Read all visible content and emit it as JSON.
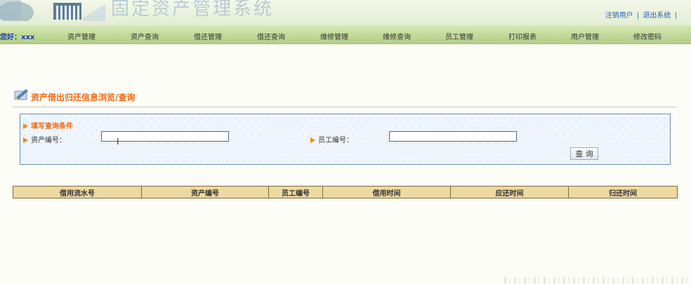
{
  "banner": {
    "system_title": "固定资产管理系统",
    "links": {
      "logout_user": "注销用户",
      "exit_system": "退出系统",
      "separator": "|"
    }
  },
  "nav": {
    "greeting": "您好：xxx",
    "items": [
      {
        "label": "资产管理"
      },
      {
        "label": "资产查询"
      },
      {
        "label": "借还管理"
      },
      {
        "label": "借还查询"
      },
      {
        "label": "维修管理"
      },
      {
        "label": "维修查询"
      },
      {
        "label": "员工管理"
      },
      {
        "label": "打印报表"
      },
      {
        "label": "用户管理"
      },
      {
        "label": "修改密码"
      }
    ]
  },
  "page": {
    "title": "资产借出归还信息浏览/查询"
  },
  "search": {
    "hint": "填写查询条件",
    "asset_label": "资产编号：",
    "asset_value": "",
    "employee_label": "员工编号：",
    "employee_value": "",
    "button_label": "查 询"
  },
  "table": {
    "columns": [
      "借用流水号",
      "资产编号",
      "员工编号",
      "借用时间",
      "应还时间",
      "归还时间"
    ],
    "rows": []
  },
  "colors": {
    "nav_green": "#c2d99a",
    "title_orange": "#ee6a14",
    "link_blue": "#2a5fb0",
    "header_tan": "#efd9a2"
  },
  "icons": {
    "logo": "building-logo-icon",
    "page": "pencil-document-icon",
    "bullet": "arrow-right-icon",
    "cursor": "text-cursor-icon"
  }
}
